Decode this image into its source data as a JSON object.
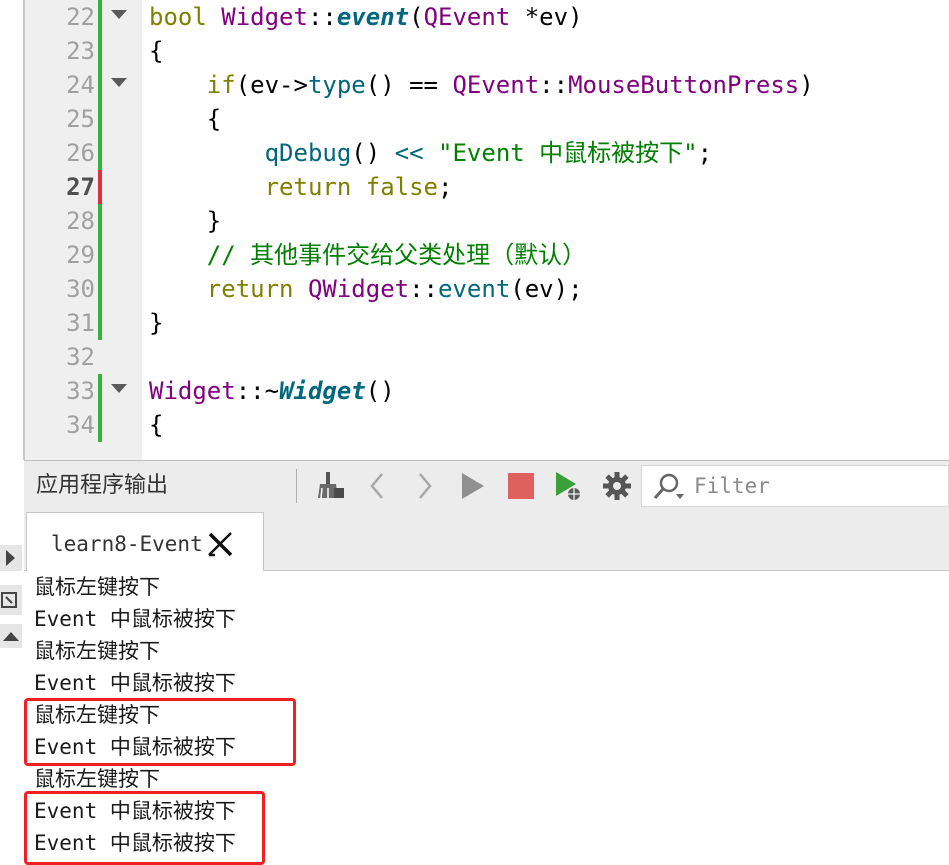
{
  "editor": {
    "lines": [
      {
        "num": "22",
        "fold": true,
        "mark": "green",
        "current": false,
        "tokens": [
          [
            "t-kw",
            "bool "
          ],
          [
            "t-type",
            "Widget"
          ],
          [
            "t-plain",
            "::"
          ],
          [
            "t-fnb",
            "event"
          ],
          [
            "t-plain",
            "("
          ],
          [
            "t-type",
            "QEvent"
          ],
          [
            "t-plain",
            " *ev)"
          ]
        ]
      },
      {
        "num": "23",
        "fold": false,
        "mark": "green",
        "current": false,
        "tokens": [
          [
            "t-plain",
            "{"
          ]
        ]
      },
      {
        "num": "24",
        "fold": true,
        "mark": "green",
        "current": false,
        "tokens": [
          [
            "t-plain",
            "    "
          ],
          [
            "t-kw",
            "if"
          ],
          [
            "t-plain",
            "(ev->"
          ],
          [
            "t-fn",
            "type"
          ],
          [
            "t-plain",
            "() == "
          ],
          [
            "t-type",
            "QEvent"
          ],
          [
            "t-plain",
            "::"
          ],
          [
            "t-type",
            "MouseButtonPress"
          ],
          [
            "t-plain",
            ")"
          ]
        ]
      },
      {
        "num": "25",
        "fold": false,
        "mark": "green",
        "current": false,
        "tokens": [
          [
            "t-plain",
            "    {"
          ]
        ]
      },
      {
        "num": "26",
        "fold": false,
        "mark": "green",
        "current": false,
        "tokens": [
          [
            "t-plain",
            "        "
          ],
          [
            "t-fn",
            "qDebug"
          ],
          [
            "t-plain",
            "() "
          ],
          [
            "t-fn",
            "<<"
          ],
          [
            "t-plain",
            " "
          ],
          [
            "t-str",
            "\"Event 中鼠标被按下\""
          ],
          [
            "t-plain",
            ";"
          ]
        ]
      },
      {
        "num": "27",
        "fold": false,
        "mark": "red",
        "current": true,
        "tokens": [
          [
            "t-plain",
            "        "
          ],
          [
            "t-kw",
            "return false"
          ],
          [
            "t-plain",
            ";"
          ]
        ]
      },
      {
        "num": "28",
        "fold": false,
        "mark": "green",
        "current": false,
        "tokens": [
          [
            "t-plain",
            "    }"
          ]
        ]
      },
      {
        "num": "29",
        "fold": false,
        "mark": "green",
        "current": false,
        "tokens": [
          [
            "t-plain",
            "    "
          ],
          [
            "t-com",
            "// 其他事件交给父类处理（默认）"
          ]
        ]
      },
      {
        "num": "30",
        "fold": false,
        "mark": "green",
        "current": false,
        "tokens": [
          [
            "t-plain",
            "    "
          ],
          [
            "t-kw",
            "return "
          ],
          [
            "t-type",
            "QWidget"
          ],
          [
            "t-plain",
            "::"
          ],
          [
            "t-fn",
            "event"
          ],
          [
            "t-plain",
            "(ev);"
          ]
        ]
      },
      {
        "num": "31",
        "fold": false,
        "mark": "green",
        "current": false,
        "tokens": [
          [
            "t-plain",
            "}"
          ]
        ]
      },
      {
        "num": "32",
        "fold": false,
        "mark": "none",
        "current": false,
        "tokens": []
      },
      {
        "num": "33",
        "fold": true,
        "mark": "green",
        "current": false,
        "tokens": [
          [
            "t-type",
            "Widget"
          ],
          [
            "t-plain",
            "::~"
          ],
          [
            "t-fnb",
            "Widget"
          ],
          [
            "t-plain",
            "()"
          ]
        ]
      },
      {
        "num": "34",
        "fold": false,
        "mark": "green",
        "current": false,
        "tokens": [
          [
            "t-plain",
            "{"
          ]
        ]
      }
    ]
  },
  "output_pane": {
    "title": "应用程序输出",
    "filter_placeholder": "Filter",
    "tab_label": "learn8-Event",
    "lines": [
      "鼠标左键按下",
      "Event 中鼠标被按下",
      "鼠标左键按下",
      "Event 中鼠标被按下",
      "鼠标左键按下",
      "Event 中鼠标被按下",
      "鼠标左键按下",
      "Event 中鼠标被按下",
      "Event 中鼠标被按下"
    ]
  },
  "colors": {
    "highlight_box": "#f02020",
    "stop_button": "#e06060",
    "run_button": "#909090",
    "debug_run_button": "#3aa03a"
  },
  "icons": {
    "clear": "broom-icon",
    "prev": "chevron-left-icon",
    "next": "chevron-right-icon",
    "run": "play-icon",
    "stop": "stop-icon",
    "debug": "debug-run-icon",
    "settings": "gear-icon",
    "filter": "magnifier-icon",
    "close_tab": "close-icon"
  }
}
